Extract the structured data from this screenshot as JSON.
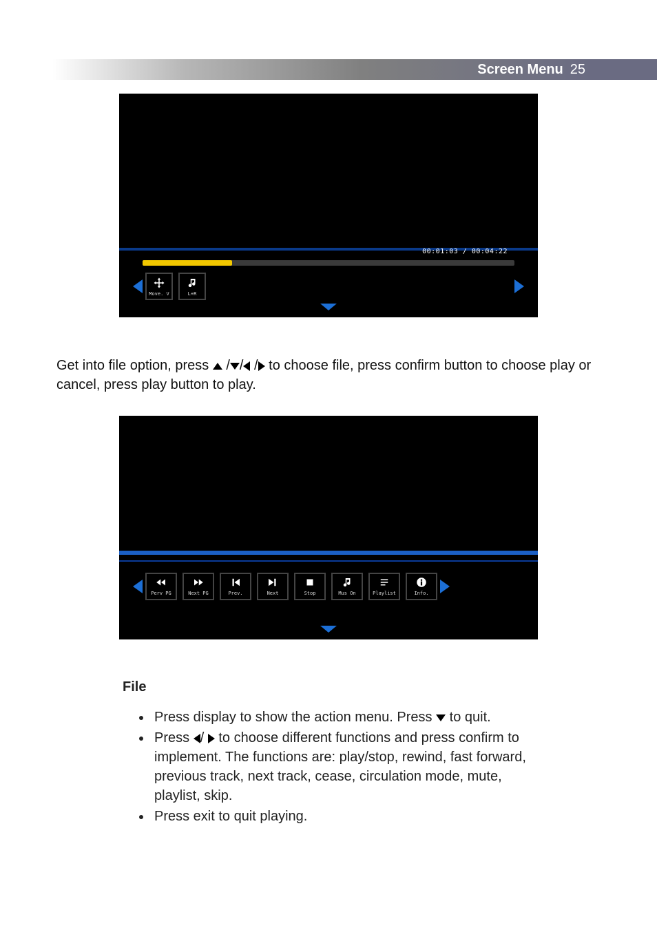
{
  "header": {
    "title": "Screen Menu",
    "page_number": "25"
  },
  "shot1": {
    "timecode": "00:01:03 / 00:04:22",
    "buttons": [
      {
        "id": "move-view",
        "label": "Move. V"
      },
      {
        "id": "audio-lr",
        "label": "L+R"
      }
    ]
  },
  "paragraph1_pre": "Get into file option, press ",
  "paragraph1_post": " to choose file, press confirm button to choose play or cancel, press play button to play.",
  "shot2": {
    "buttons": [
      {
        "id": "perv-pg",
        "label": "Perv PG"
      },
      {
        "id": "next-pg",
        "label": "Next PG"
      },
      {
        "id": "prev",
        "label": "Prev."
      },
      {
        "id": "next",
        "label": "Next"
      },
      {
        "id": "stop",
        "label": "Stop"
      },
      {
        "id": "mus-on",
        "label": "Mus On"
      },
      {
        "id": "playlist",
        "label": "Playlist"
      },
      {
        "id": "info",
        "label": "Info."
      }
    ]
  },
  "file_section": {
    "heading": "File",
    "items": [
      {
        "pre": "Press display to show the action menu. Press ",
        "post": " to quit.",
        "glyphs": [
          "down"
        ]
      },
      {
        "pre": "Press ",
        "post": " to choose different functions and press confirm to implement. The functions are: play/stop, rewind, fast forward, previous track, next track, cease, circulation mode, mute, playlist, skip.",
        "glyphs": [
          "left",
          "right"
        ]
      },
      {
        "pre": "Press exit to quit playing.",
        "post": "",
        "glyphs": []
      }
    ]
  }
}
